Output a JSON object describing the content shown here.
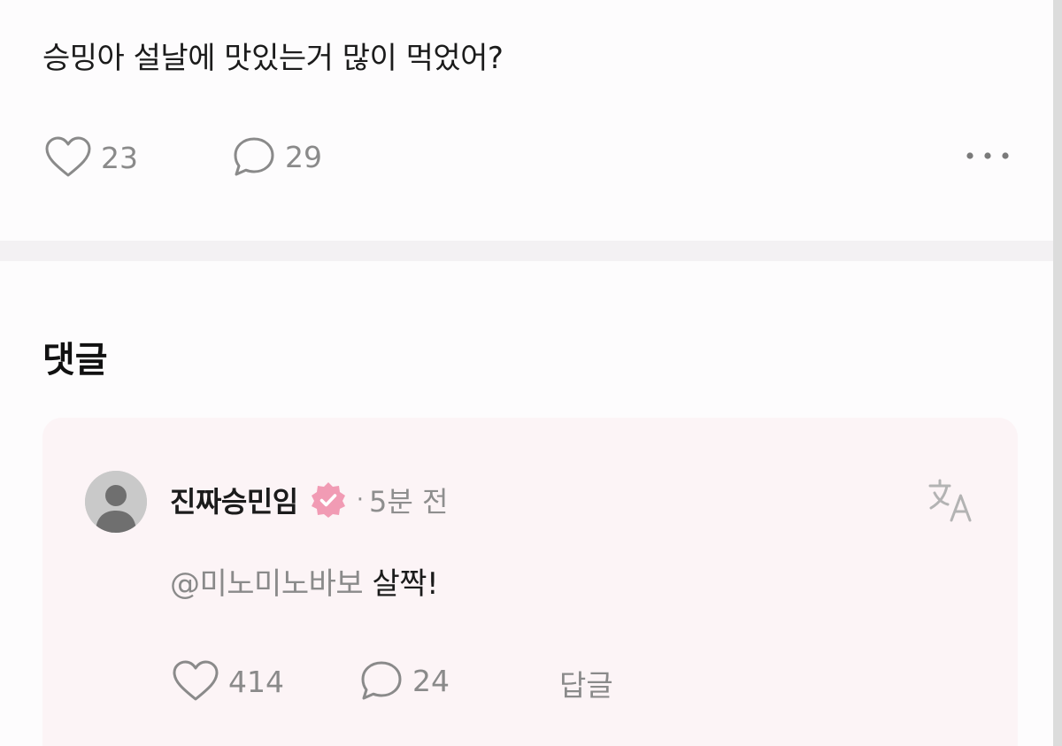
{
  "post": {
    "text": "승밍아 설날에 맛있는거 많이 먹었어?",
    "likes": "23",
    "comments": "29"
  },
  "comments_section": {
    "heading": "댓글"
  },
  "comment": {
    "author": "진짜승민임",
    "dot": "·",
    "time": "5분 전",
    "mention": "@미노미노바보",
    "text": "살짝!",
    "likes": "414",
    "replies": "24",
    "reply_label": "답글"
  },
  "colors": {
    "background": "#fdfcfd",
    "card": "#fcf4f6",
    "verified_badge": "#f19bb4",
    "muted_text": "#8a8a8a"
  },
  "icons": [
    "heart-icon",
    "speech-bubble-icon",
    "more-options-icon",
    "verified-badge-icon",
    "translate-icon"
  ]
}
